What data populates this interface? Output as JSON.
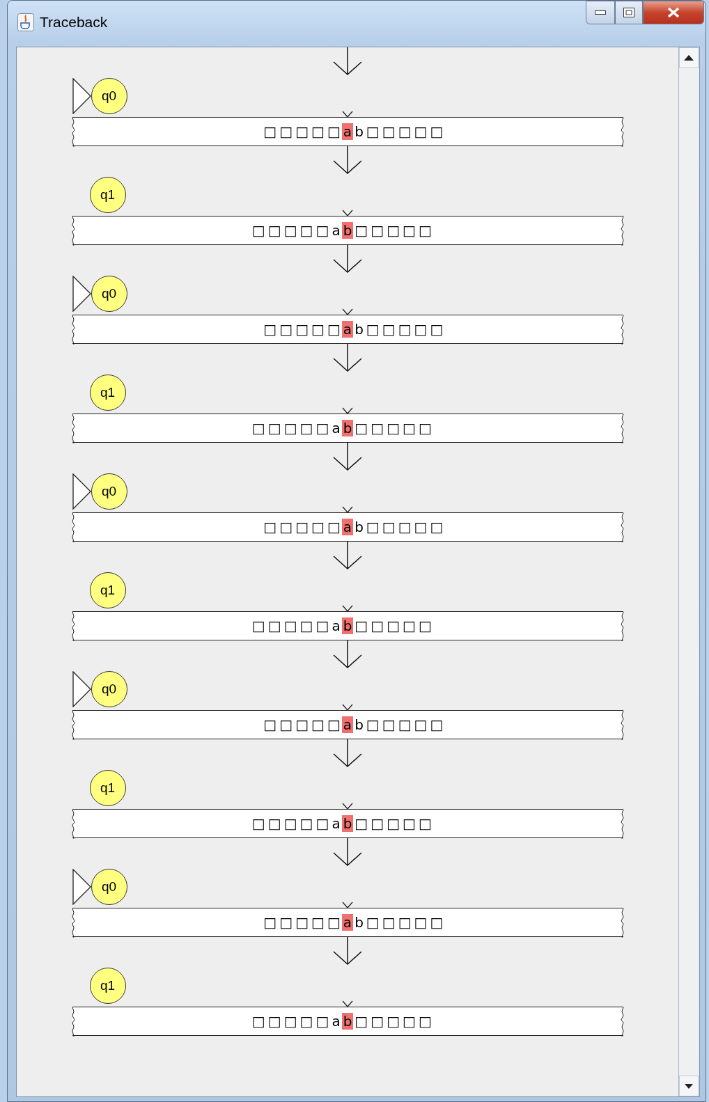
{
  "window": {
    "title": "Traceback"
  },
  "configurations": [
    {
      "state": "q0",
      "initial": true,
      "cells": [
        {
          "symbol": "□",
          "selected": false
        },
        {
          "symbol": "□",
          "selected": false
        },
        {
          "symbol": "□",
          "selected": false
        },
        {
          "symbol": "□",
          "selected": false
        },
        {
          "symbol": "□",
          "selected": false
        },
        {
          "symbol": "a",
          "selected": true
        },
        {
          "symbol": "b",
          "selected": false
        },
        {
          "symbol": "□",
          "selected": false
        },
        {
          "symbol": "□",
          "selected": false
        },
        {
          "symbol": "□",
          "selected": false
        },
        {
          "symbol": "□",
          "selected": false
        },
        {
          "symbol": "□",
          "selected": false
        }
      ]
    },
    {
      "state": "q1",
      "initial": false,
      "cells": [
        {
          "symbol": "□",
          "selected": false
        },
        {
          "symbol": "□",
          "selected": false
        },
        {
          "symbol": "□",
          "selected": false
        },
        {
          "symbol": "□",
          "selected": false
        },
        {
          "symbol": "□",
          "selected": false
        },
        {
          "symbol": "a",
          "selected": false
        },
        {
          "symbol": "b",
          "selected": true
        },
        {
          "symbol": "□",
          "selected": false
        },
        {
          "symbol": "□",
          "selected": false
        },
        {
          "symbol": "□",
          "selected": false
        },
        {
          "symbol": "□",
          "selected": false
        },
        {
          "symbol": "□",
          "selected": false
        }
      ]
    },
    {
      "state": "q0",
      "initial": true,
      "cells": [
        {
          "symbol": "□",
          "selected": false
        },
        {
          "symbol": "□",
          "selected": false
        },
        {
          "symbol": "□",
          "selected": false
        },
        {
          "symbol": "□",
          "selected": false
        },
        {
          "symbol": "□",
          "selected": false
        },
        {
          "symbol": "a",
          "selected": true
        },
        {
          "symbol": "b",
          "selected": false
        },
        {
          "symbol": "□",
          "selected": false
        },
        {
          "symbol": "□",
          "selected": false
        },
        {
          "symbol": "□",
          "selected": false
        },
        {
          "symbol": "□",
          "selected": false
        },
        {
          "symbol": "□",
          "selected": false
        }
      ]
    },
    {
      "state": "q1",
      "initial": false,
      "cells": [
        {
          "symbol": "□",
          "selected": false
        },
        {
          "symbol": "□",
          "selected": false
        },
        {
          "symbol": "□",
          "selected": false
        },
        {
          "symbol": "□",
          "selected": false
        },
        {
          "symbol": "□",
          "selected": false
        },
        {
          "symbol": "a",
          "selected": false
        },
        {
          "symbol": "b",
          "selected": true
        },
        {
          "symbol": "□",
          "selected": false
        },
        {
          "symbol": "□",
          "selected": false
        },
        {
          "symbol": "□",
          "selected": false
        },
        {
          "symbol": "□",
          "selected": false
        },
        {
          "symbol": "□",
          "selected": false
        }
      ]
    },
    {
      "state": "q0",
      "initial": true,
      "cells": [
        {
          "symbol": "□",
          "selected": false
        },
        {
          "symbol": "□",
          "selected": false
        },
        {
          "symbol": "□",
          "selected": false
        },
        {
          "symbol": "□",
          "selected": false
        },
        {
          "symbol": "□",
          "selected": false
        },
        {
          "symbol": "a",
          "selected": true
        },
        {
          "symbol": "b",
          "selected": false
        },
        {
          "symbol": "□",
          "selected": false
        },
        {
          "symbol": "□",
          "selected": false
        },
        {
          "symbol": "□",
          "selected": false
        },
        {
          "symbol": "□",
          "selected": false
        },
        {
          "symbol": "□",
          "selected": false
        }
      ]
    },
    {
      "state": "q1",
      "initial": false,
      "cells": [
        {
          "symbol": "□",
          "selected": false
        },
        {
          "symbol": "□",
          "selected": false
        },
        {
          "symbol": "□",
          "selected": false
        },
        {
          "symbol": "□",
          "selected": false
        },
        {
          "symbol": "□",
          "selected": false
        },
        {
          "symbol": "a",
          "selected": false
        },
        {
          "symbol": "b",
          "selected": true
        },
        {
          "symbol": "□",
          "selected": false
        },
        {
          "symbol": "□",
          "selected": false
        },
        {
          "symbol": "□",
          "selected": false
        },
        {
          "symbol": "□",
          "selected": false
        },
        {
          "symbol": "□",
          "selected": false
        }
      ]
    },
    {
      "state": "q0",
      "initial": true,
      "cells": [
        {
          "symbol": "□",
          "selected": false
        },
        {
          "symbol": "□",
          "selected": false
        },
        {
          "symbol": "□",
          "selected": false
        },
        {
          "symbol": "□",
          "selected": false
        },
        {
          "symbol": "□",
          "selected": false
        },
        {
          "symbol": "a",
          "selected": true
        },
        {
          "symbol": "b",
          "selected": false
        },
        {
          "symbol": "□",
          "selected": false
        },
        {
          "symbol": "□",
          "selected": false
        },
        {
          "symbol": "□",
          "selected": false
        },
        {
          "symbol": "□",
          "selected": false
        },
        {
          "symbol": "□",
          "selected": false
        }
      ]
    },
    {
      "state": "q1",
      "initial": false,
      "cells": [
        {
          "symbol": "□",
          "selected": false
        },
        {
          "symbol": "□",
          "selected": false
        },
        {
          "symbol": "□",
          "selected": false
        },
        {
          "symbol": "□",
          "selected": false
        },
        {
          "symbol": "□",
          "selected": false
        },
        {
          "symbol": "a",
          "selected": false
        },
        {
          "symbol": "b",
          "selected": true
        },
        {
          "symbol": "□",
          "selected": false
        },
        {
          "symbol": "□",
          "selected": false
        },
        {
          "symbol": "□",
          "selected": false
        },
        {
          "symbol": "□",
          "selected": false
        },
        {
          "symbol": "□",
          "selected": false
        }
      ]
    },
    {
      "state": "q0",
      "initial": true,
      "cells": [
        {
          "symbol": "□",
          "selected": false
        },
        {
          "symbol": "□",
          "selected": false
        },
        {
          "symbol": "□",
          "selected": false
        },
        {
          "symbol": "□",
          "selected": false
        },
        {
          "symbol": "□",
          "selected": false
        },
        {
          "symbol": "a",
          "selected": true
        },
        {
          "symbol": "b",
          "selected": false
        },
        {
          "symbol": "□",
          "selected": false
        },
        {
          "symbol": "□",
          "selected": false
        },
        {
          "symbol": "□",
          "selected": false
        },
        {
          "symbol": "□",
          "selected": false
        },
        {
          "symbol": "□",
          "selected": false
        }
      ]
    },
    {
      "state": "q1",
      "initial": false,
      "cells": [
        {
          "symbol": "□",
          "selected": false
        },
        {
          "symbol": "□",
          "selected": false
        },
        {
          "symbol": "□",
          "selected": false
        },
        {
          "symbol": "□",
          "selected": false
        },
        {
          "symbol": "□",
          "selected": false
        },
        {
          "symbol": "a",
          "selected": false
        },
        {
          "symbol": "b",
          "selected": true
        },
        {
          "symbol": "□",
          "selected": false
        },
        {
          "symbol": "□",
          "selected": false
        },
        {
          "symbol": "□",
          "selected": false
        },
        {
          "symbol": "□",
          "selected": false
        },
        {
          "symbol": "□",
          "selected": false
        }
      ]
    }
  ]
}
